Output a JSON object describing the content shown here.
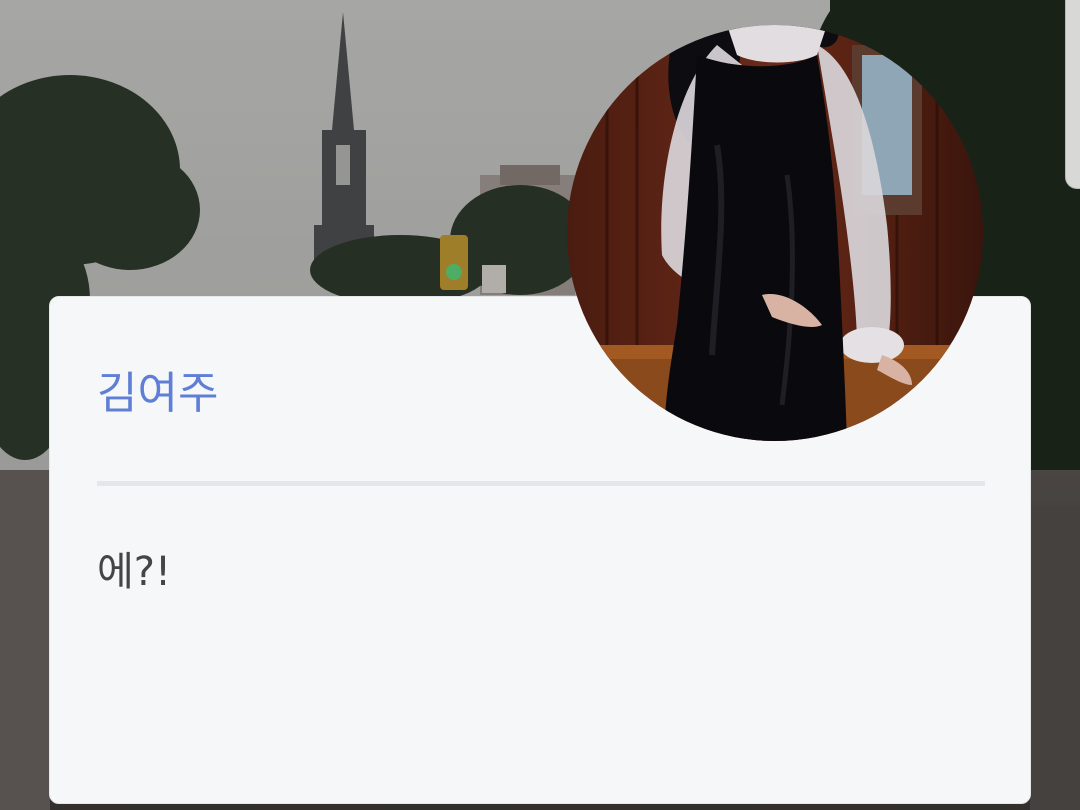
{
  "dialog": {
    "speaker_name": "김여주",
    "message": "에?!",
    "speaker_color": "#5f7fd6",
    "card_color": "#f6f7f9"
  },
  "background": {
    "scene": "street-with-church-steeple"
  },
  "portrait": {
    "subject": "character-portrait-black-dress"
  }
}
